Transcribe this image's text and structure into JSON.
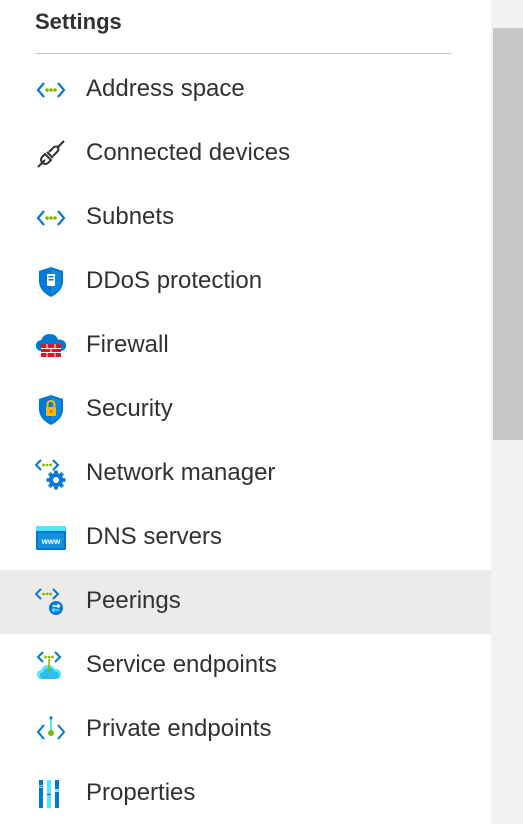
{
  "section": {
    "title": "Settings"
  },
  "items": [
    {
      "label": "Address space",
      "icon": "address-space-icon"
    },
    {
      "label": "Connected devices",
      "icon": "plug-icon"
    },
    {
      "label": "Subnets",
      "icon": "subnets-icon"
    },
    {
      "label": "DDoS protection",
      "icon": "ddos-shield-icon"
    },
    {
      "label": "Firewall",
      "icon": "firewall-icon"
    },
    {
      "label": "Security",
      "icon": "security-shield-icon"
    },
    {
      "label": "Network manager",
      "icon": "network-manager-icon"
    },
    {
      "label": "DNS servers",
      "icon": "dns-icon"
    },
    {
      "label": "Peerings",
      "icon": "peerings-icon",
      "selected": true
    },
    {
      "label": "Service endpoints",
      "icon": "service-endpoints-icon"
    },
    {
      "label": "Private endpoints",
      "icon": "private-endpoints-icon"
    },
    {
      "label": "Properties",
      "icon": "properties-icon"
    }
  ],
  "colors": {
    "accent_blue": "#0078d4",
    "light_blue": "#50e6ff",
    "green": "#7fba00",
    "selected_bg": "#edebe9",
    "text": "#323130"
  }
}
